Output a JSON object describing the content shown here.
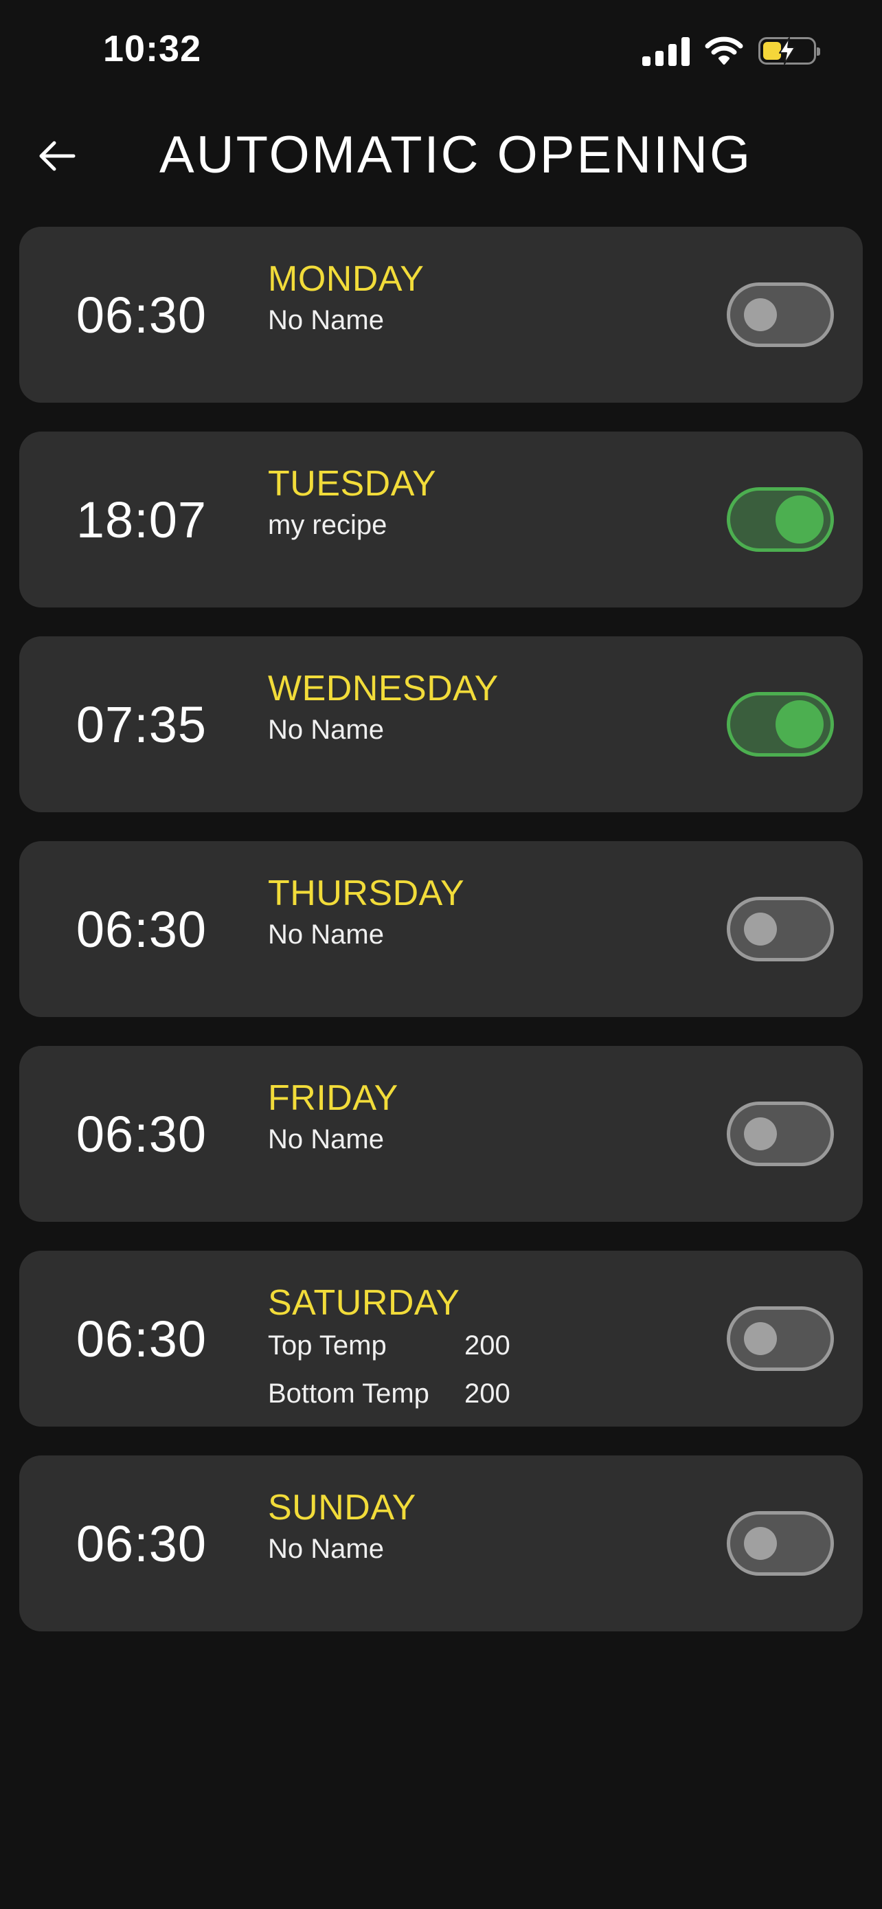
{
  "status_bar": {
    "time": "10:32",
    "battery_color": "#f5d63a",
    "icons": [
      "signal-icon",
      "wifi-icon",
      "battery-charging-icon"
    ]
  },
  "header": {
    "title": "AUTOMATIC OPENING",
    "back_icon": "arrow-left-icon"
  },
  "colors": {
    "background": "#121212",
    "card": "#2f2f2f",
    "day_label": "#f2dc3a",
    "toggle_on": "#4caf50",
    "toggle_off": "#555555"
  },
  "schedules": [
    {
      "time": "06:30",
      "day": "MONDAY",
      "name": "No Name",
      "enabled": false
    },
    {
      "time": "18:07",
      "day": "TUESDAY",
      "name": "my recipe",
      "enabled": true
    },
    {
      "time": "07:35",
      "day": "WEDNESDAY",
      "name": "No Name",
      "enabled": true
    },
    {
      "time": "06:30",
      "day": "THURSDAY",
      "name": "No Name",
      "enabled": false
    },
    {
      "time": "06:30",
      "day": "FRIDAY",
      "name": "No Name",
      "enabled": false
    },
    {
      "time": "06:30",
      "day": "SATURDAY",
      "params": [
        {
          "label": "Top Temp",
          "value": "200"
        },
        {
          "label": "Bottom Temp",
          "value": "200"
        }
      ],
      "enabled": false
    },
    {
      "time": "06:30",
      "day": "SUNDAY",
      "name": "No Name",
      "enabled": false
    }
  ]
}
